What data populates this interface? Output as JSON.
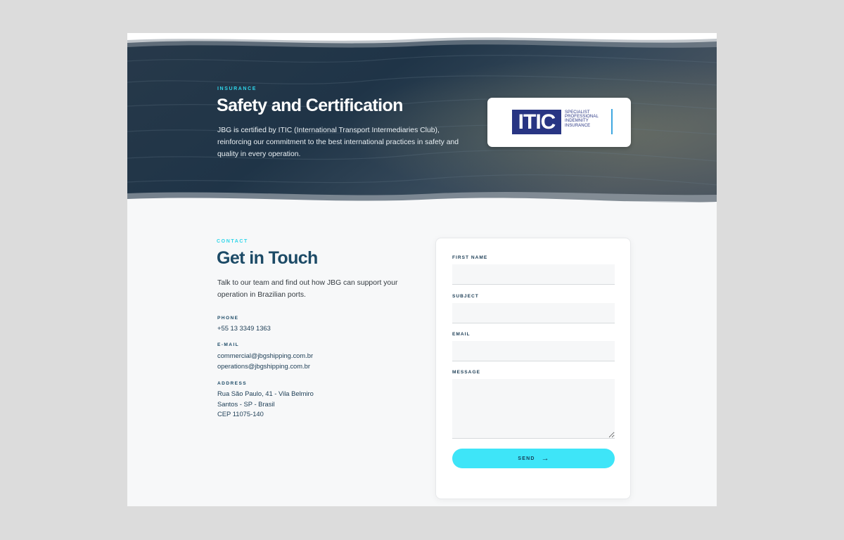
{
  "hero": {
    "eyebrow": "INSURANCE",
    "title": "Safety and Certification",
    "text": "JBG is certified by ITIC (International Transport Intermediaries Club), reinforcing our commitment to the best international practices in safety and quality in every operation.",
    "logo": {
      "mark": "ITIC",
      "tagline": "SPECIALIST PROFESSIONAL INDEMNITY INSURANCE",
      "brand_color": "#283583",
      "accent_color": "#3fa7e0"
    }
  },
  "contact": {
    "eyebrow": "CONTACT",
    "title": "Get in Touch",
    "intro": "Talk to our team and find out how JBG can support your operation in Brazilian ports.",
    "phone_label": "PHONE",
    "phone": "+55 13 3349 1363",
    "email_label": "E-MAIL",
    "email_commercial": "commercial@jbgshipping.com.br",
    "email_operations": "operations@jbgshipping.com.br",
    "address_label": "ADDRESS",
    "address_line1": "Rua São Paulo, 41 - Vila Belmiro",
    "address_line2": "Santos - SP - Brasil",
    "address_line3": "CEP 11075-140"
  },
  "form": {
    "first_name_label": "FIRST NAME",
    "first_name_value": "",
    "subject_label": "SUBJECT",
    "subject_value": "",
    "email_label": "EMAIL",
    "email_value": "",
    "message_label": "MESSAGE",
    "message_value": "",
    "send_label": "SEND",
    "send_icon": "arrow-right-icon"
  },
  "colors": {
    "accent": "#3ee5f8",
    "heading": "#1c4a66",
    "sea": "#22394d"
  }
}
